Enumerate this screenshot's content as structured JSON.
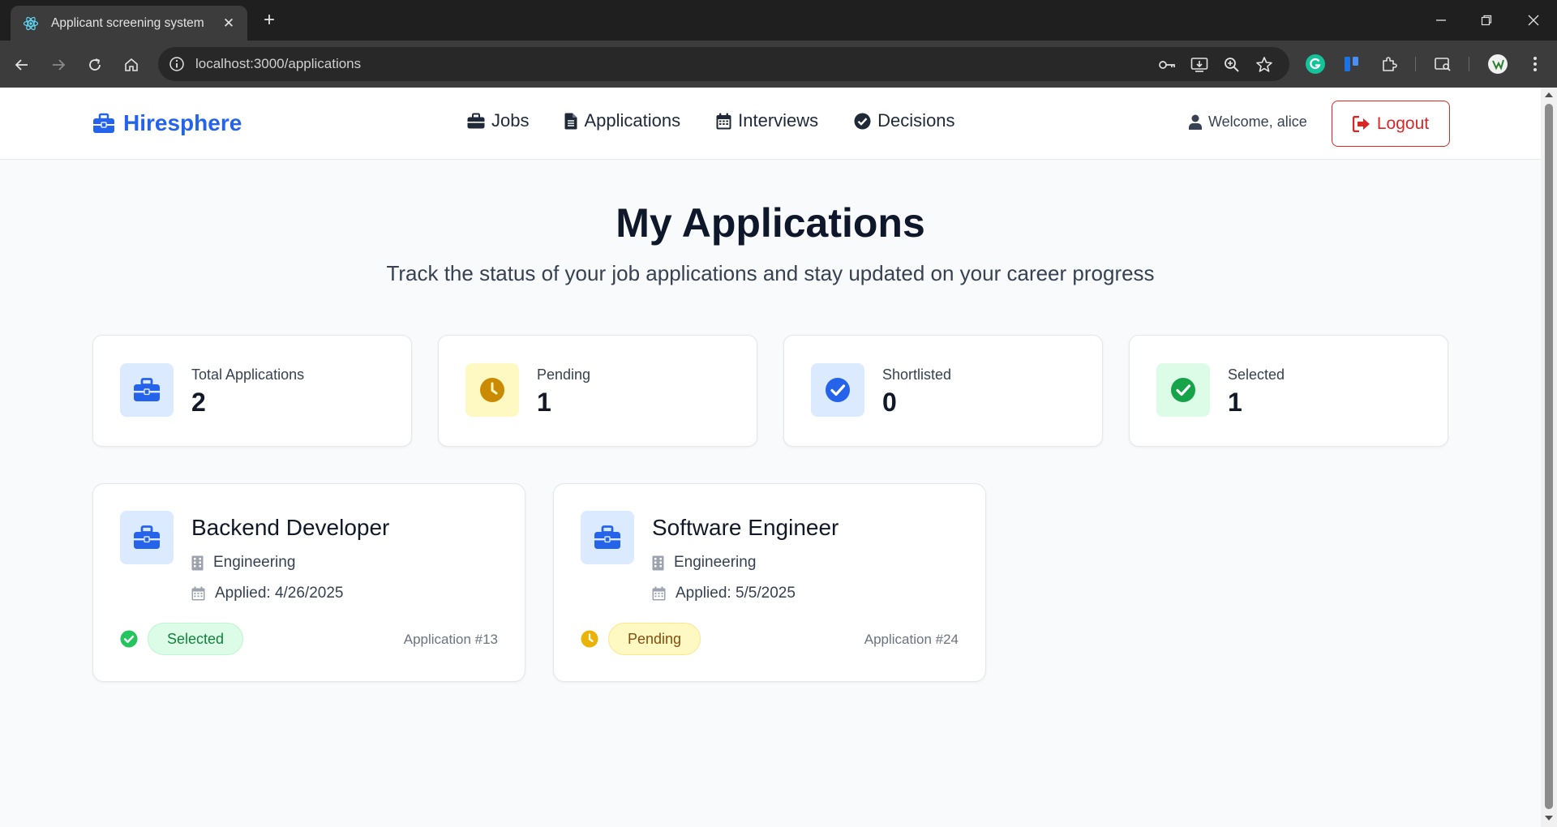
{
  "browser": {
    "tab_title": "Applicant screening system",
    "url": "localhost:3000/applications"
  },
  "app": {
    "brand": "Hiresphere",
    "nav": [
      {
        "label": "Jobs",
        "icon": "briefcase-icon"
      },
      {
        "label": "Applications",
        "icon": "file-icon"
      },
      {
        "label": "Interviews",
        "icon": "calendar-icon"
      },
      {
        "label": "Decisions",
        "icon": "check-circle-icon"
      }
    ],
    "welcome": "Welcome, alice",
    "logout": "Logout"
  },
  "page": {
    "title": "My Applications",
    "subtitle": "Track the status of your job applications and stay updated on your career progress"
  },
  "stats": [
    {
      "label": "Total Applications",
      "value": "2",
      "icon": "briefcase-icon",
      "accent": "#2563eb",
      "bg": "#dbeafe"
    },
    {
      "label": "Pending",
      "value": "1",
      "icon": "clock-icon",
      "accent": "#ca8a04",
      "bg": "#fef9c3"
    },
    {
      "label": "Shortlisted",
      "value": "0",
      "icon": "check-circle-icon",
      "accent": "#2563eb",
      "bg": "#dbeafe"
    },
    {
      "label": "Selected",
      "value": "1",
      "icon": "check-circle-icon",
      "accent": "#16a34a",
      "bg": "#dcfce7"
    }
  ],
  "applications": [
    {
      "title": "Backend Developer",
      "department": "Engineering",
      "applied": "Applied: 4/26/2025",
      "status": "Selected",
      "status_color": "#15803d",
      "status_bg": "#dcfce7",
      "status_icon_color": "#22c55e",
      "number": "Application #13"
    },
    {
      "title": "Software Engineer",
      "department": "Engineering",
      "applied": "Applied: 5/5/2025",
      "status": "Pending",
      "status_color": "#854d0e",
      "status_bg": "#fef9c3",
      "status_icon_color": "#eab308",
      "number": "Application #24"
    }
  ]
}
